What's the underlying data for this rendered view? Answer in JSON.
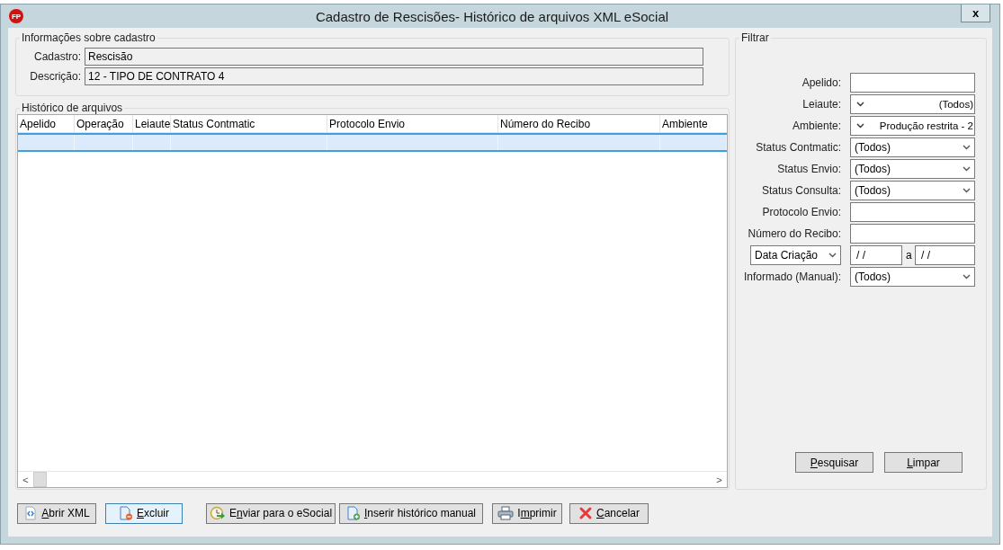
{
  "window": {
    "app_icon": "FP",
    "title": "Cadastro de Rescisões- Histórico de arquivos XML eSocial",
    "close": "x"
  },
  "info": {
    "legend": "Informações sobre cadastro",
    "fields": [
      {
        "label": "Cadastro:",
        "value": "Rescisão"
      },
      {
        "label": "Descrição:",
        "value": "12 - TIPO DE CONTRATO 4"
      }
    ]
  },
  "history": {
    "legend": "Histórico de arquivos",
    "columns": [
      "Apelido",
      "Operação",
      "Leiaute",
      "Status Contmatic",
      "Protocolo Envio",
      "Número do Recibo",
      "Ambiente"
    ],
    "rows": [
      {
        "selected": true
      }
    ],
    "scroll_left": "<",
    "scroll_right": ">"
  },
  "filter": {
    "legend": "Filtrar",
    "fields": [
      {
        "kind": "text",
        "label": "Apelido:"
      },
      {
        "kind": "combo_left",
        "label": "Leiaute:",
        "value": "(Todos)"
      },
      {
        "kind": "combo_left",
        "label": "Ambiente:",
        "value": "Produção restrita - 2"
      },
      {
        "kind": "combo",
        "label": "Status Contmatic:",
        "value": "(Todos)"
      },
      {
        "kind": "combo",
        "label": "Status Envio:",
        "value": "(Todos)"
      },
      {
        "kind": "combo",
        "label": "Status Consulta:",
        "value": "(Todos)"
      },
      {
        "kind": "text",
        "label": "Protocolo Envio:"
      },
      {
        "kind": "text",
        "label": "Número do Recibo:"
      },
      {
        "kind": "date_range",
        "select": "Data Criação",
        "from": "/ /",
        "separator": "a",
        "to": "/ /"
      },
      {
        "kind": "combo",
        "label": "Informado (Manual):",
        "value": "(Todos)"
      }
    ],
    "buttons": [
      {
        "key": "P",
        "rest": "esquisar"
      },
      {
        "key": "L",
        "rest": "impar"
      }
    ]
  },
  "buttons": [
    {
      "key": "A",
      "rest": "brir XML",
      "focused": false
    },
    {
      "key": "E",
      "rest": "xcluir",
      "focused": true
    },
    {
      "pre": "E",
      "key": "n",
      "rest": "viar para o eSocial",
      "focused": false
    },
    {
      "key": "I",
      "rest": "nserir histórico manual",
      "focused": false
    },
    {
      "pre": "I",
      "key": "m",
      "rest": "primir",
      "focused": false
    },
    {
      "key": "C",
      "rest": "ancelar",
      "focused": false
    }
  ]
}
